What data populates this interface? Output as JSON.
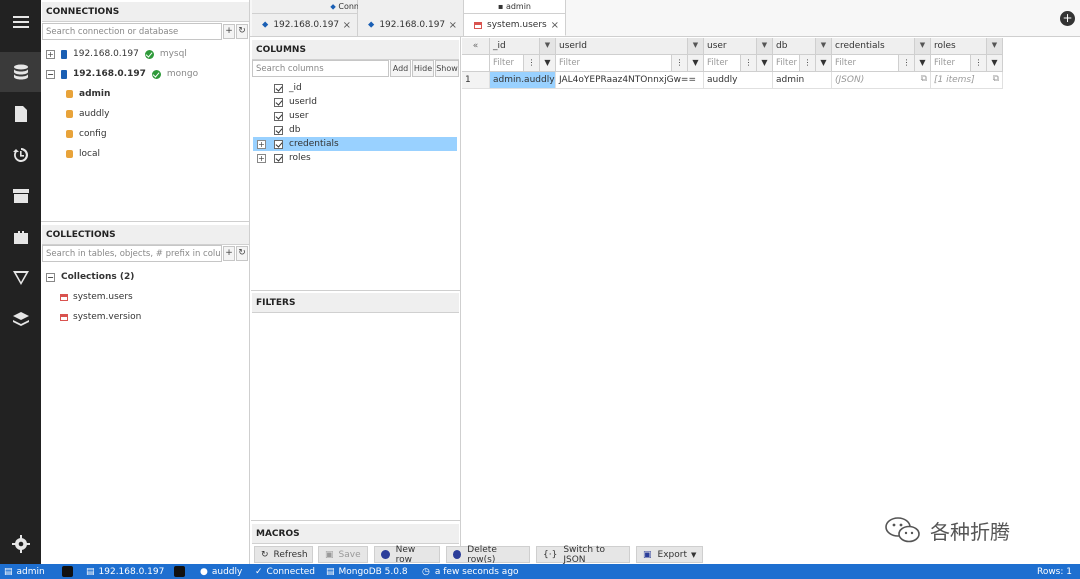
{
  "connections": {
    "header": "CONNECTIONS",
    "search_placeholder": "Search connection or database",
    "servers": [
      {
        "host": "192.168.0.197",
        "type": "mysql"
      },
      {
        "host": "192.168.0.197",
        "type": "mongo"
      }
    ],
    "databases": [
      "admin",
      "auddly",
      "config",
      "local"
    ]
  },
  "collections": {
    "header": "COLLECTIONS",
    "search_placeholder": "Search in tables, objects, # prefix in columns",
    "group": "Collections (2)",
    "items": [
      "system.users",
      "system.version"
    ]
  },
  "tabs": [
    {
      "top": "Connections",
      "label": "192.168.0.197"
    },
    {
      "top": "",
      "label": "192.168.0.197"
    },
    {
      "top": "admin",
      "label": "system.users"
    }
  ],
  "columns_panel": {
    "header": "COLUMNS",
    "search_placeholder": "Search columns",
    "add": "Add",
    "hide": "Hide",
    "show": "Show",
    "items": [
      "_id",
      "userId",
      "user",
      "db",
      "credentials",
      "roles"
    ]
  },
  "filters_header": "FILTERS",
  "macros_header": "MACROS",
  "grid": {
    "collapse": "«",
    "headers": [
      "_id",
      "userId",
      "user",
      "db",
      "credentials",
      "roles"
    ],
    "filter_placeholder": "Filter",
    "row": {
      "num": "1",
      "id": "admin.auddly",
      "userId": "JAL4oYEPRaaz4NTOnnxjGw==",
      "user": "auddly",
      "db": "admin",
      "credentials": "(JSON)",
      "roles": "[1 items]"
    }
  },
  "toolbar": {
    "refresh": "Refresh",
    "save": "Save",
    "new_row": "New row",
    "delete_row": "Delete row(s)",
    "switch_json": "Switch to JSON",
    "export": "Export"
  },
  "status": {
    "db": "admin",
    "server": "192.168.0.197",
    "user": "auddly",
    "connected": "Connected",
    "version": "MongoDB 5.0.8",
    "time": "a few seconds ago",
    "rows": "Rows: 1"
  },
  "watermark": "各种折腾",
  "colors": {
    "accent": "#1e6fd0",
    "selection": "#99d1ff",
    "sidebar": "#222222"
  }
}
